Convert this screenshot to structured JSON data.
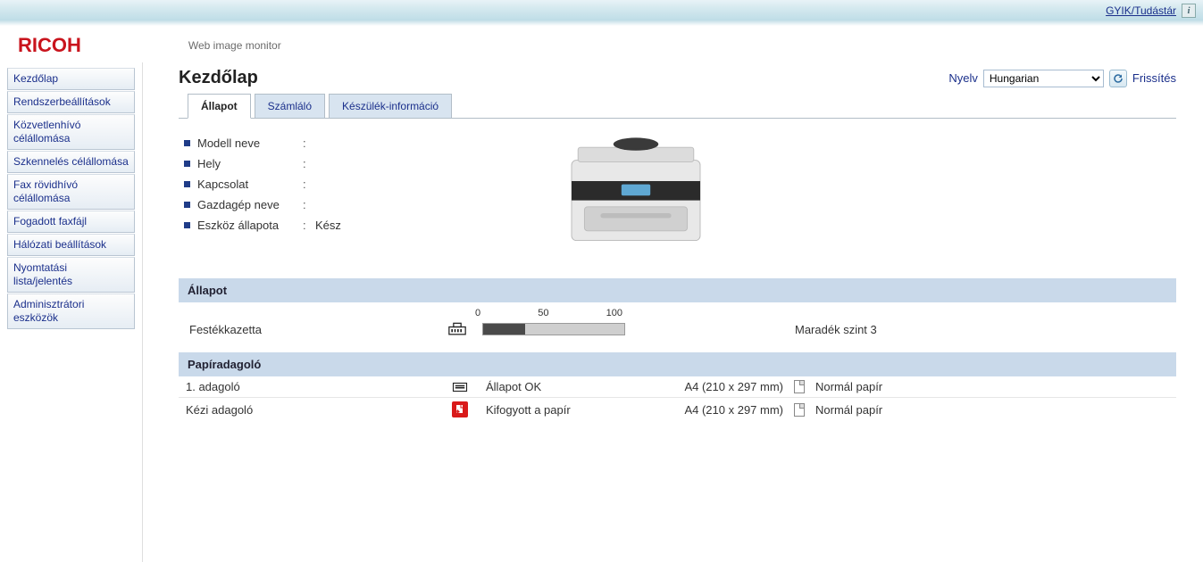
{
  "top": {
    "faq_link": "GYIK/Tudástár",
    "info_glyph": "i"
  },
  "header": {
    "logo": "RICOH",
    "subtitle": "Web image monitor"
  },
  "sidebar": {
    "items": [
      "Kezdőlap",
      "Rendszerbeállítások",
      "Közvetlenhívó célállomása",
      "Szkennelés célállomása",
      "Fax rövidhívó célállomása",
      "Fogadott faxfájl",
      "Hálózati beállítások",
      "Nyomtatási lista/jelentés",
      "Adminisztrátori eszközök"
    ]
  },
  "page": {
    "title": "Kezdőlap"
  },
  "lang": {
    "label": "Nyelv",
    "selected": "Hungarian",
    "options": [
      "Hungarian"
    ],
    "refresh": "Frissítés"
  },
  "tabs": [
    {
      "label": "Állapot",
      "active": true
    },
    {
      "label": "Számláló",
      "active": false
    },
    {
      "label": "Készülék-információ",
      "active": false
    }
  ],
  "device": {
    "rows": [
      {
        "label": "Modell neve",
        "value": ""
      },
      {
        "label": "Hely",
        "value": ""
      },
      {
        "label": "Kapcsolat",
        "value": ""
      },
      {
        "label": "Gazdagép neve",
        "value": ""
      },
      {
        "label": "Eszköz állapota",
        "value": "Kész"
      }
    ]
  },
  "status": {
    "heading": "Állapot",
    "scale": {
      "min": "0",
      "mid": "50",
      "max": "100"
    },
    "toner": {
      "label": "Festékkazetta",
      "remaining_text": "Maradék szint 3",
      "fill_percent": 30
    }
  },
  "paper": {
    "heading": "Papíradagoló",
    "trays": [
      {
        "name": "1. adagoló",
        "status_icon": "tray-ok",
        "status_text": "Állapot OK",
        "size": "A4 (210 x 297 mm)",
        "type": "Normál papír"
      },
      {
        "name": "Kézi adagoló",
        "status_icon": "tray-error",
        "status_text": "Kifogyott a papír",
        "size": "A4 (210 x 297 mm)",
        "type": "Normál papír"
      }
    ]
  }
}
